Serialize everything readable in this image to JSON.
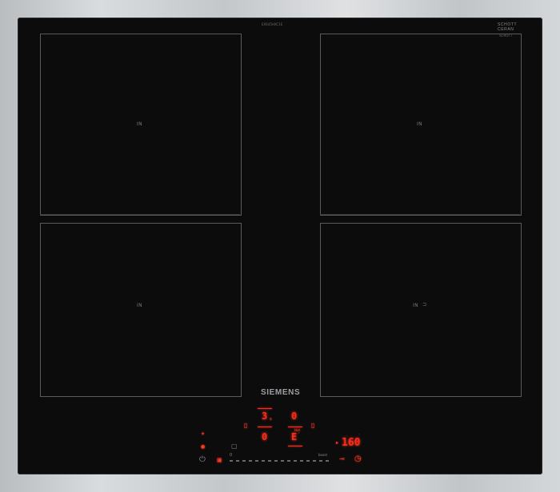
{
  "hob": {
    "brand": "SIEMENS",
    "glass_brand_line1": "SCHOTT",
    "glass_brand_line2": "CERAN",
    "glass_brand_small": "SCHOTT",
    "model_code": "EX645HXC1E",
    "zone_labels": [
      "IN",
      "IN",
      "IN",
      "IN"
    ],
    "zone4_extra": "⊐"
  },
  "controls": {
    "zone_top_left_level": "3",
    "zone_top_left_suffix": "s",
    "zone_top_right_level": "0",
    "zone_bottom_left_level": "0",
    "zone_bottom_right_level": "E",
    "zone_bottom_right_suffix": "'",
    "zone_bottom_right_small": "Hot",
    "timer_display": "160",
    "slider_start_label": "0",
    "slider_end_label": "boost",
    "power_icon": "power-icon",
    "lock_icon": "lock-icon",
    "timer_icon": "timer-icon",
    "accent_color": "#ff2a1a"
  }
}
